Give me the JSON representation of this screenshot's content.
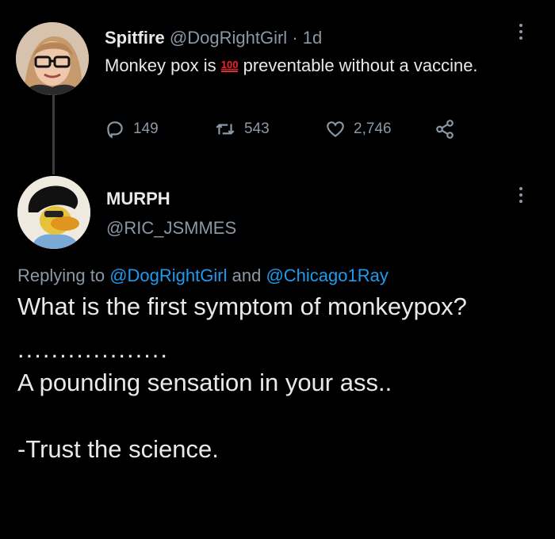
{
  "tweet": {
    "name": "Spitfire",
    "handle": "@DogRightGirl",
    "dot": "·",
    "time": "1d",
    "text_before": "Monkey pox is",
    "emoji": "100",
    "text_after": "preventable without a vaccine.",
    "replies": "149",
    "retweets": "543",
    "likes": "2,746"
  },
  "reply": {
    "name": "MURPH",
    "handle": "@RIC_JSMMES",
    "replying_prefix": "Replying to",
    "mention1": "@DogRightGirl",
    "and": "and",
    "mention2": "@Chicago1Ray",
    "line1": "What is the first symptom of monkeypox?",
    "separator": "..................",
    "line2": "A pounding sensation in your ass..",
    "line3": "-Trust the science."
  },
  "colors": {
    "background": "#000000",
    "text": "#e7e9ea",
    "muted": "#8b98a5",
    "link": "#1d9bf0",
    "emoji_red": "#f4212e"
  },
  "icons": [
    "reply-icon",
    "retweet-icon",
    "like-icon",
    "share-icon",
    "more-icon"
  ]
}
